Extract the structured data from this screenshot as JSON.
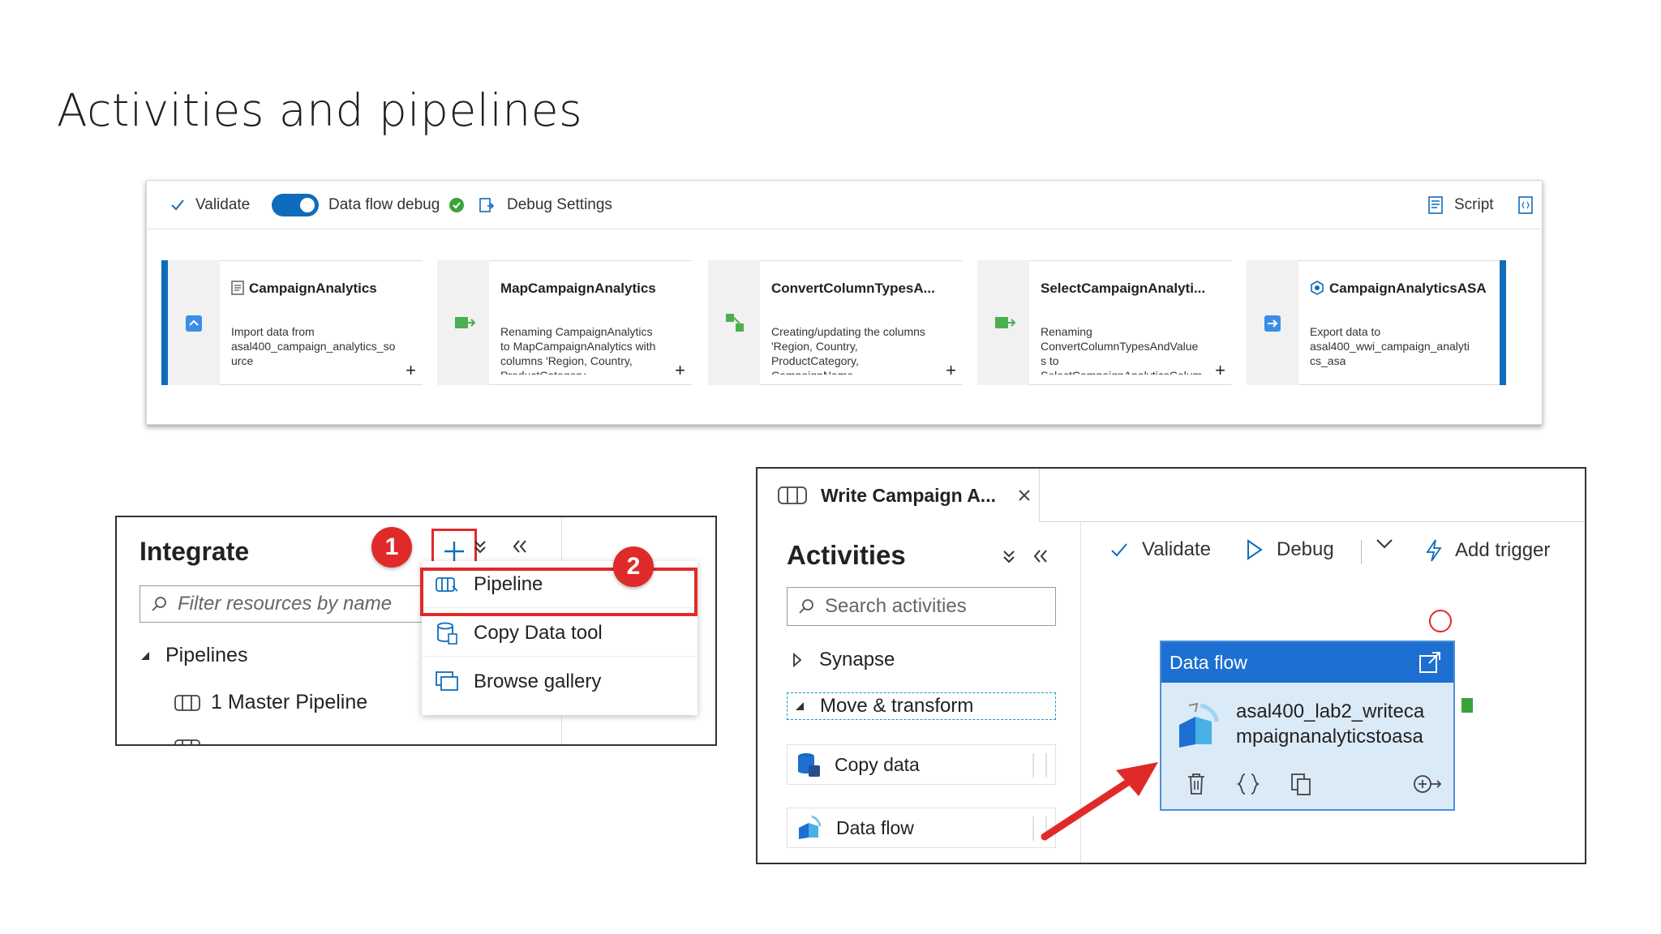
{
  "slide": {
    "title": "Activities and pipelines"
  },
  "dataflow": {
    "toolbar": {
      "validate": "Validate",
      "debug_label": "Data flow debug",
      "debug_settings": "Debug Settings",
      "script": "Script"
    },
    "stages": [
      {
        "title": "CampaignAnalytics",
        "desc": "Import data from\nasal400_campaign_analytics_so\nurce"
      },
      {
        "title": "MapCampaignAnalytics",
        "desc": "Renaming CampaignAnalytics\nto MapCampaignAnalytics with\ncolumns 'Region, Country,\nProductCategory,"
      },
      {
        "title": "ConvertColumnTypesA...",
        "desc": "Creating/updating the columns\n'Region, Country,\nProductCategory,\nCampaignName,"
      },
      {
        "title": "SelectCampaignAnalyti...",
        "desc": "Renaming\nConvertColumnTypesAndValue\ns to\nSelectCampaignAnalyticsColum"
      },
      {
        "title": "CampaignAnalyticsASA",
        "desc": "Export data to\nasal400_wwi_campaign_analyti\ncs_asa"
      }
    ]
  },
  "integrate": {
    "title": "Integrate",
    "filter_placeholder": "Filter resources by name",
    "pipelines_header": "Pipelines",
    "pipeline_item": "1 Master Pipeline",
    "menu": [
      "Pipeline",
      "Copy Data tool",
      "Browse gallery"
    ],
    "badge1": "1",
    "badge2": "2"
  },
  "pipeline_editor": {
    "tab_title": "Write Campaign A...",
    "activities_title": "Activities",
    "search_placeholder": "Search activities",
    "groups": {
      "synapse": "Synapse",
      "move_transform": "Move & transform"
    },
    "tiles": [
      "Copy data",
      "Data flow"
    ],
    "toolbar": {
      "validate": "Validate",
      "debug": "Debug",
      "add_trigger": "Add trigger"
    },
    "card": {
      "header": "Data flow",
      "name": "asal400_lab2_writecampaignanalyticstoasa"
    }
  },
  "colors": {
    "accent": "#0f6cbd",
    "badge": "#e02a2a",
    "highlight_box": "#e02a2a",
    "success": "#3aa43a"
  }
}
